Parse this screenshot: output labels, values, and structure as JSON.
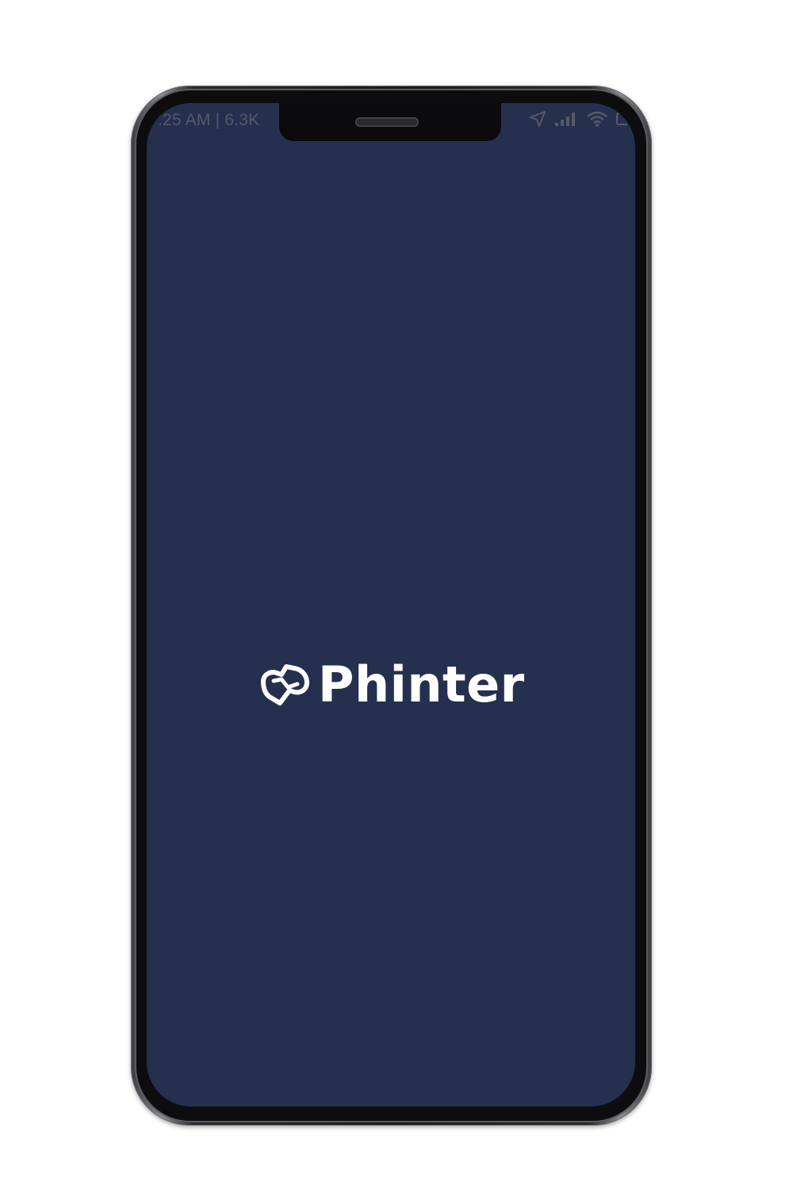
{
  "status_bar": {
    "left_text": ".25 AM | 6.3K",
    "icons": [
      "location-arrow-icon",
      "signal-bars-icon",
      "wifi-icon",
      "battery-icon"
    ]
  },
  "splash": {
    "brand_name": "Phinter",
    "logo_icon": "phinter-logo-icon"
  },
  "colors": {
    "screen_background": "#252f4e",
    "logo": "#ffffff"
  }
}
